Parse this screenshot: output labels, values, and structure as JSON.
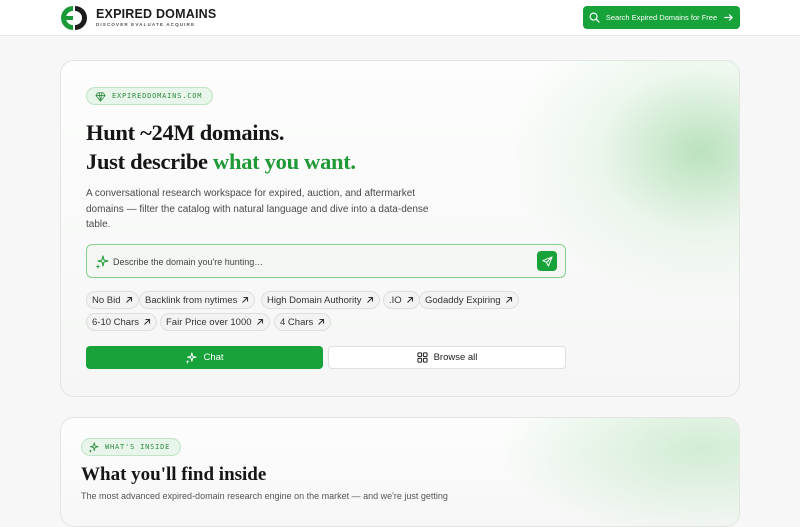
{
  "header": {
    "logo_name": "EXPIRED DOMAINS",
    "logo_tagline": "DISCOVER EVALUATE ACQUIRE",
    "search_cta_label": "Search Expired Domains for Free"
  },
  "hero": {
    "badge": "EXPIREDDOMAINS.COM",
    "title_line1": "Hunt ~24M domains.",
    "title_line2_prefix": "Just describe ",
    "title_line2_highlight": "what you want.",
    "description": "A conversational research workspace for expired, auction, and aftermarket domains — filter the catalog with natural language and dive into a data-dense table.",
    "prompt_placeholder": "Describe the domain you're hunting…",
    "chips": [
      {
        "label": "No Bid"
      },
      {
        "label": "Backlink from nytimes"
      },
      {
        "label": "High Domain Authority"
      },
      {
        "label": ".IO"
      },
      {
        "label": "Godaddy Expiring"
      },
      {
        "label": "6-10 Chars"
      },
      {
        "label": "Fair Price over 1000"
      },
      {
        "label": "4 Chars"
      }
    ],
    "chat_label": "Chat",
    "browse_label": "Browse all"
  },
  "inside": {
    "badge": "WHAT'S INSIDE",
    "title": "What you'll find inside",
    "description": "The most advanced expired-domain research engine on the market — and we're just getting"
  },
  "colors": {
    "brand": "#17a23a",
    "highlight": "#1f9a36",
    "badge_bg": "#e8f5ea"
  }
}
